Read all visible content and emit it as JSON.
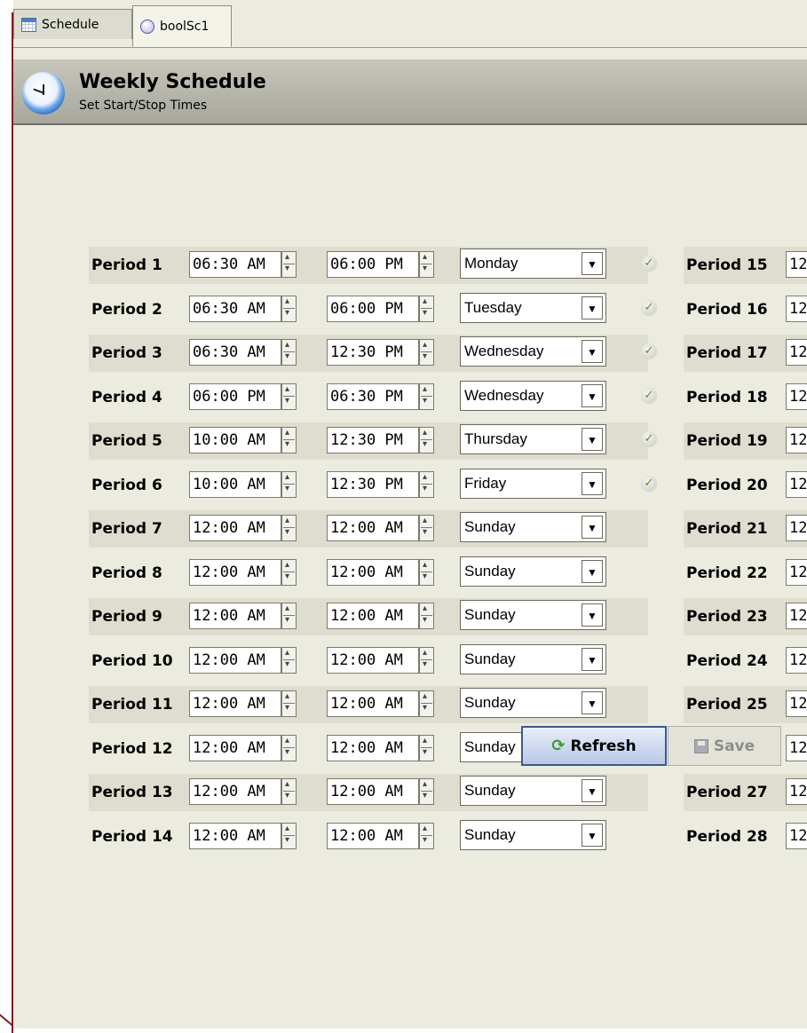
{
  "tabs": [
    {
      "label": "Schedule",
      "icon": "calendar-icon"
    },
    {
      "label": "boolSc1",
      "icon": "circle-icon"
    }
  ],
  "header": {
    "title": "Weekly Schedule",
    "subtitle": "Set Start/Stop Times",
    "icon": "clock-icon"
  },
  "periods_left": [
    {
      "label": "Period 1",
      "start": "06:30 AM",
      "stop": "06:00 PM",
      "day": "Monday",
      "active": true
    },
    {
      "label": "Period 2",
      "start": "06:30 AM",
      "stop": "06:00 PM",
      "day": "Tuesday",
      "active": true
    },
    {
      "label": "Period 3",
      "start": "06:30 AM",
      "stop": "12:30 PM",
      "day": "Wednesday",
      "active": true
    },
    {
      "label": "Period 4",
      "start": "06:00 PM",
      "stop": "06:30 PM",
      "day": "Wednesday",
      "active": true
    },
    {
      "label": "Period 5",
      "start": "10:00 AM",
      "stop": "12:30 PM",
      "day": "Thursday",
      "active": true
    },
    {
      "label": "Period 6",
      "start": "10:00 AM",
      "stop": "12:30 PM",
      "day": "Friday",
      "active": true
    },
    {
      "label": "Period 7",
      "start": "12:00 AM",
      "stop": "12:00 AM",
      "day": "Sunday",
      "active": false
    },
    {
      "label": "Period 8",
      "start": "12:00 AM",
      "stop": "12:00 AM",
      "day": "Sunday",
      "active": false
    },
    {
      "label": "Period 9",
      "start": "12:00 AM",
      "stop": "12:00 AM",
      "day": "Sunday",
      "active": false
    },
    {
      "label": "Period 10",
      "start": "12:00 AM",
      "stop": "12:00 AM",
      "day": "Sunday",
      "active": false
    },
    {
      "label": "Period 11",
      "start": "12:00 AM",
      "stop": "12:00 AM",
      "day": "Sunday",
      "active": false
    },
    {
      "label": "Period 12",
      "start": "12:00 AM",
      "stop": "12:00 AM",
      "day": "Sunday",
      "active": false
    },
    {
      "label": "Period 13",
      "start": "12:00 AM",
      "stop": "12:00 AM",
      "day": "Sunday",
      "active": false
    },
    {
      "label": "Period 14",
      "start": "12:00 AM",
      "stop": "12:00 AM",
      "day": "Sunday",
      "active": false
    }
  ],
  "periods_right": [
    {
      "label": "Period 15",
      "start": "12"
    },
    {
      "label": "Period 16",
      "start": "12"
    },
    {
      "label": "Period 17",
      "start": "12"
    },
    {
      "label": "Period 18",
      "start": "12"
    },
    {
      "label": "Period 19",
      "start": "12"
    },
    {
      "label": "Period 20",
      "start": "12"
    },
    {
      "label": "Period 21",
      "start": "12"
    },
    {
      "label": "Period 22",
      "start": "12"
    },
    {
      "label": "Period 23",
      "start": "12"
    },
    {
      "label": "Period 24",
      "start": "12"
    },
    {
      "label": "Period 25",
      "start": "12"
    },
    {
      "label": "Period 26",
      "start": "12"
    },
    {
      "label": "Period 27",
      "start": "12"
    },
    {
      "label": "Period 28",
      "start": "12"
    }
  ],
  "buttons": {
    "refresh_label": "Refresh",
    "save_label": "Save"
  },
  "colors": {
    "background": "#ecebdf",
    "row_alt": "#deddd0",
    "header_bar": "#b8b7ac",
    "frame_line": "#7a1f1f"
  }
}
